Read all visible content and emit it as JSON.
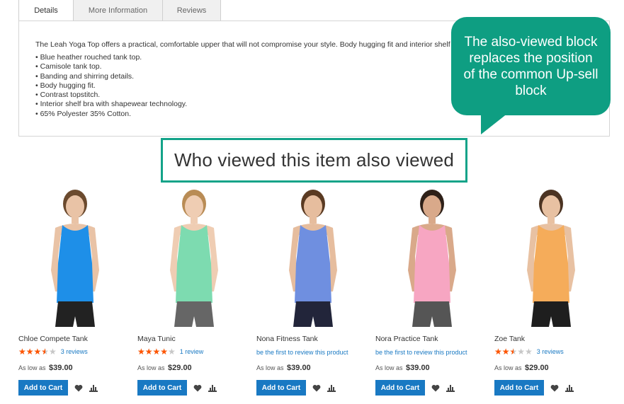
{
  "tabs": [
    {
      "label": "Details"
    },
    {
      "label": "More Information"
    },
    {
      "label": "Reviews"
    }
  ],
  "details": {
    "description": "The Leah Yoga Top offers a practical, comfortable upper that will not compromise your style. Body hugging fit and interior shelf bra ma",
    "features": [
      "Blue heather rouched tank top.",
      "Camisole tank top.",
      "Banding and shirring details.",
      "Body hugging fit.",
      "Contrast topstitch.",
      "Interior shelf bra with shapewear technology.",
      "65% Polyester 35% Cotton."
    ]
  },
  "callout": {
    "text": "The also-viewed block replaces the position of the common Up-sell block"
  },
  "section": {
    "heading": "Who viewed this item also viewed"
  },
  "colors": {
    "accent": "#13a389",
    "callout": "#0e9e82",
    "button": "#1979c3",
    "star": "#ff5501"
  },
  "products": [
    {
      "name": "Chloe Compete Tank",
      "rating": 0.7,
      "reviews_text": "3 reviews",
      "price_prefix": "As low as",
      "price": "$39.00",
      "button": "Add to Cart",
      "top_color": "#1e8fe8",
      "bottom_color": "#222222",
      "skin": "#e9c3a6",
      "hair": "#6b4a2e"
    },
    {
      "name": "Maya Tunic",
      "rating": 0.8,
      "reviews_text": "1 review",
      "price_prefix": "As low as",
      "price": "$29.00",
      "button": "Add to Cart",
      "top_color": "#7ddbb0",
      "bottom_color": "#666666",
      "skin": "#efcdb3",
      "hair": "#b98c55"
    },
    {
      "name": "Nona Fitness Tank",
      "rating": 0,
      "reviews_text": "be the first to review this product",
      "price_prefix": "As low as",
      "price": "$39.00",
      "button": "Add to Cart",
      "top_color": "#6f8fe0",
      "bottom_color": "#22253a",
      "skin": "#e6bd9e",
      "hair": "#5a3a22"
    },
    {
      "name": "Nora Practice Tank",
      "rating": 0,
      "reviews_text": "be the first to review this product",
      "price_prefix": "As low as",
      "price": "$39.00",
      "button": "Add to Cart",
      "top_color": "#f7a6c2",
      "bottom_color": "#555555",
      "skin": "#d9a98a",
      "hair": "#2e2018"
    },
    {
      "name": "Zoe Tank",
      "rating": 0.5,
      "reviews_text": "3 reviews",
      "price_prefix": "As low as",
      "price": "$29.00",
      "button": "Add to Cart",
      "top_color": "#f5ac5a",
      "bottom_color": "#1e1e1e",
      "skin": "#e8c1a2",
      "hair": "#4b3322"
    }
  ]
}
